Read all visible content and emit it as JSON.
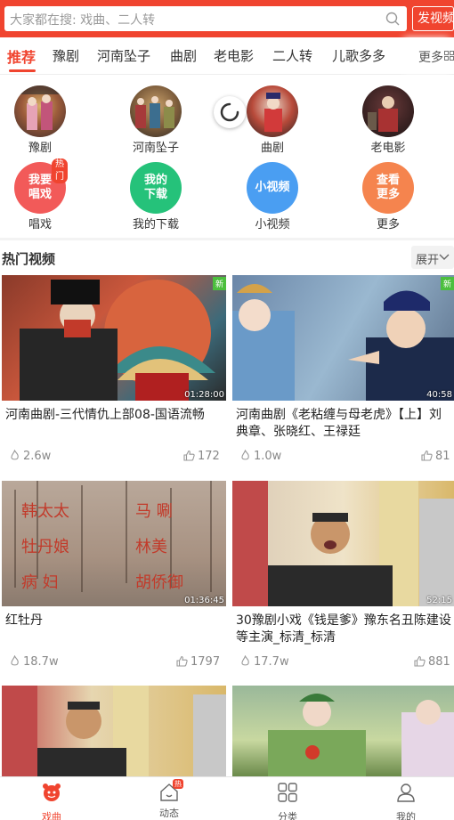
{
  "search": {
    "placeholder": "大家都在搜: 戏曲、二人转",
    "upload_label": "发视频"
  },
  "tabs": {
    "items": [
      {
        "label": "推荐",
        "active": true
      },
      {
        "label": "豫剧"
      },
      {
        "label": "河南坠子"
      },
      {
        "label": "曲剧"
      },
      {
        "label": "老电影"
      },
      {
        "label": "二人转"
      },
      {
        "label": "儿歌多多"
      }
    ],
    "more_label": "更多"
  },
  "categories": [
    {
      "label": "豫剧",
      "icon": "opera-avatar"
    },
    {
      "label": "河南坠子",
      "icon": "zhuizi-avatar"
    },
    {
      "label": "曲剧",
      "icon": "quju-avatar"
    },
    {
      "label": "老电影",
      "icon": "movie-avatar"
    }
  ],
  "shortcuts": [
    {
      "label": "唱戏",
      "circle_text": "我要唱戏",
      "color": "#f25a59",
      "badge": "热门"
    },
    {
      "label": "我的下载",
      "circle_text": "我的下载",
      "color": "#25c27a"
    },
    {
      "label": "小视频",
      "circle_text": "小视频",
      "color": "#4a9ef2"
    },
    {
      "label": "更多",
      "circle_text": "查看更多",
      "color": "#f5844e"
    }
  ],
  "hot_videos": {
    "title": "热门视频",
    "expand_label": "展开",
    "items": [
      {
        "title": "河南曲剧-三代情仇上部08-国语流畅",
        "duration": "01:28:00",
        "views": "2.6w",
        "likes": "172",
        "badge": "新"
      },
      {
        "title": "河南曲剧《老粘缠与母老虎》【上】刘典章、张晓红、王禄廷",
        "duration": "40:58",
        "views": "1.0w",
        "likes": "81",
        "badge": "新"
      },
      {
        "title": "红牡丹",
        "duration": "01:36:45",
        "views": "18.7w",
        "likes": "1797"
      },
      {
        "title": "30豫剧小戏《钱是爹》豫东名丑陈建设等主演_标清_标清",
        "duration": "52:15",
        "views": "17.7w",
        "likes": "881"
      },
      {
        "title": "",
        "duration": "",
        "views": "",
        "likes": ""
      },
      {
        "title": "",
        "duration": "",
        "views": "",
        "likes": ""
      }
    ]
  },
  "bottom_nav": {
    "items": [
      {
        "label": "戏曲",
        "active": true
      },
      {
        "label": "动态",
        "badge": "热"
      },
      {
        "label": "分类"
      },
      {
        "label": "我的"
      }
    ]
  },
  "colors": {
    "brand": "#f0442f",
    "new_badge": "#4cbf3e"
  }
}
